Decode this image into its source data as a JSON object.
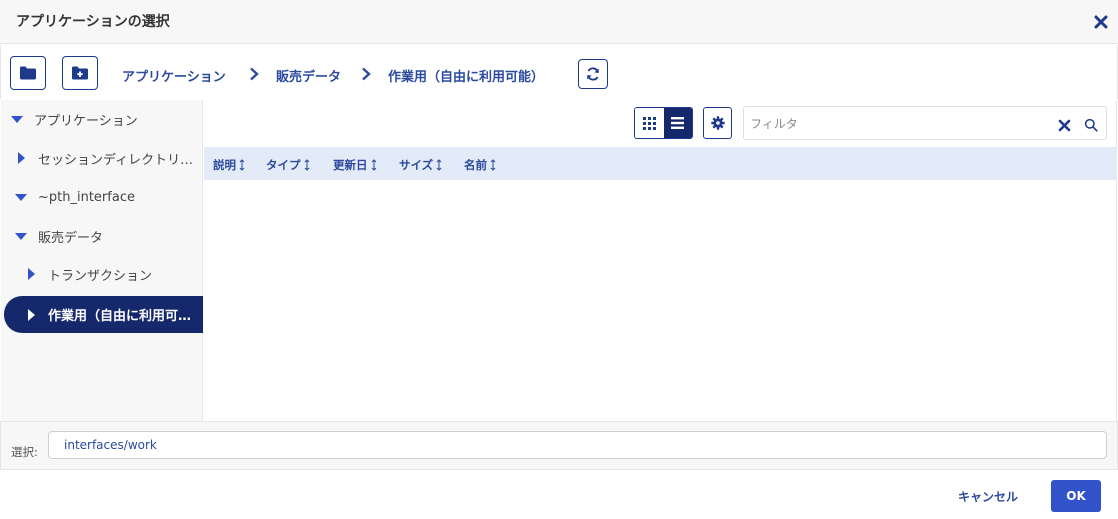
{
  "dialog": {
    "title": "アプリケーションの選択"
  },
  "breadcrumb": [
    {
      "label": "アプリケーション"
    },
    {
      "label": "販売データ"
    },
    {
      "label": "作業用（自由に利用可能）"
    }
  ],
  "tree": {
    "items": [
      {
        "label": "アプリケーション",
        "state": "expanded"
      },
      {
        "label": "セッションディレクトリ…",
        "state": "collapsed"
      },
      {
        "label": "~pth_interface",
        "state": "expanded"
      },
      {
        "label": "販売データ",
        "state": "expanded"
      },
      {
        "label": "トランザクション",
        "state": "collapsed"
      },
      {
        "label": "作業用（自由に利用可…",
        "state": "collapsed",
        "selected": true
      }
    ]
  },
  "filter": {
    "placeholder": "フィルタ",
    "value": ""
  },
  "columns": [
    {
      "label": "説明"
    },
    {
      "label": "タイプ"
    },
    {
      "label": "更新日"
    },
    {
      "label": "サイズ"
    },
    {
      "label": "名前"
    }
  ],
  "selection": {
    "label": "選択:",
    "value": "interfaces/work"
  },
  "buttons": {
    "cancel": "キャンセル",
    "ok": "OK"
  },
  "colors": {
    "primary": "#15286b",
    "accent": "#3152c9",
    "link": "#2c4a9e",
    "header_bg": "#e3eaf8"
  }
}
